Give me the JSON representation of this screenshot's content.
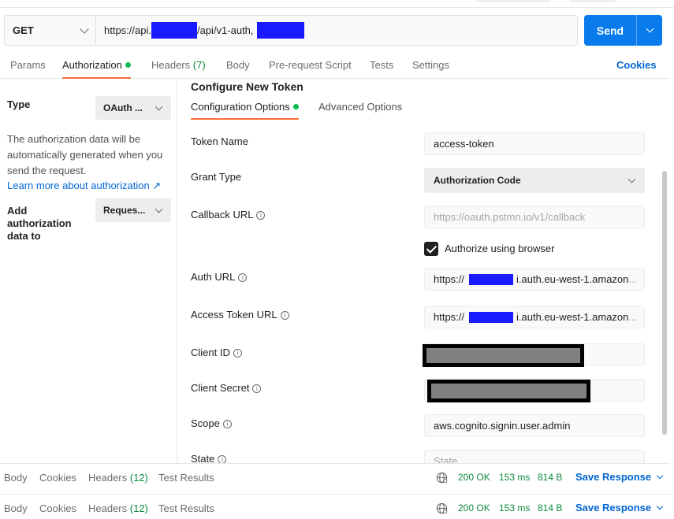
{
  "request": {
    "method": "GET",
    "url_prefix": "https://api.",
    "url_middle": "/api/v1-auth,",
    "send_label": "Send"
  },
  "tabs": [
    {
      "label": "Params"
    },
    {
      "label": "Authorization"
    },
    {
      "label": "Headers",
      "count": "(7)"
    },
    {
      "label": "Body"
    },
    {
      "label": "Pre-request Script"
    },
    {
      "label": "Tests"
    },
    {
      "label": "Settings"
    }
  ],
  "cookies_label": "Cookies",
  "left_panel": {
    "type_label": "Type",
    "type_value": "OAuth ...",
    "description": "The authorization data will be automatically generated when you send the request.",
    "learn_more": "Learn more about authorization ↗",
    "add_to_label": "Add authorization data to",
    "add_to_value": "Reques..."
  },
  "config": {
    "title": "Configure New Token",
    "subtabs": [
      "Configuration Options",
      "Advanced Options"
    ],
    "fields": {
      "token_name": {
        "label": "Token Name",
        "value": "access-token"
      },
      "grant_type": {
        "label": "Grant Type",
        "value": "Authorization Code"
      },
      "callback_url": {
        "label": "Callback URL",
        "placeholder": "https://oauth.pstmn.io/v1/callback"
      },
      "authorize_browser": {
        "label": "Authorize using browser",
        "checked": true
      },
      "auth_url": {
        "label": "Auth URL",
        "prefix": "https://",
        "suffix": "i.auth.eu-west-1.amazon",
        "ellipsis": "..."
      },
      "access_token_url": {
        "label": "Access Token URL",
        "prefix": "https://",
        "suffix": "i.auth.eu-west-1.amazon",
        "ellipsis": "..."
      },
      "client_id": {
        "label": "Client ID"
      },
      "client_secret": {
        "label": "Client Secret"
      },
      "scope": {
        "label": "Scope",
        "value": "aws.cognito.signin.user.admin"
      },
      "state": {
        "label": "State",
        "placeholder": "State"
      }
    }
  },
  "response": {
    "tabs": [
      {
        "label": "Body"
      },
      {
        "label": "Cookies"
      },
      {
        "label": "Headers",
        "count": "(12)"
      },
      {
        "label": "Test Results"
      }
    ],
    "status": "200 OK",
    "time": "153 ms",
    "size": "814 B",
    "save_label": "Save Response"
  },
  "colors": {
    "accent_send": "#097bed",
    "tab_underline": "#ff6c37",
    "status_ok": "#0c8a3e",
    "link": "#0265d2",
    "redaction": "#1a1aff"
  }
}
